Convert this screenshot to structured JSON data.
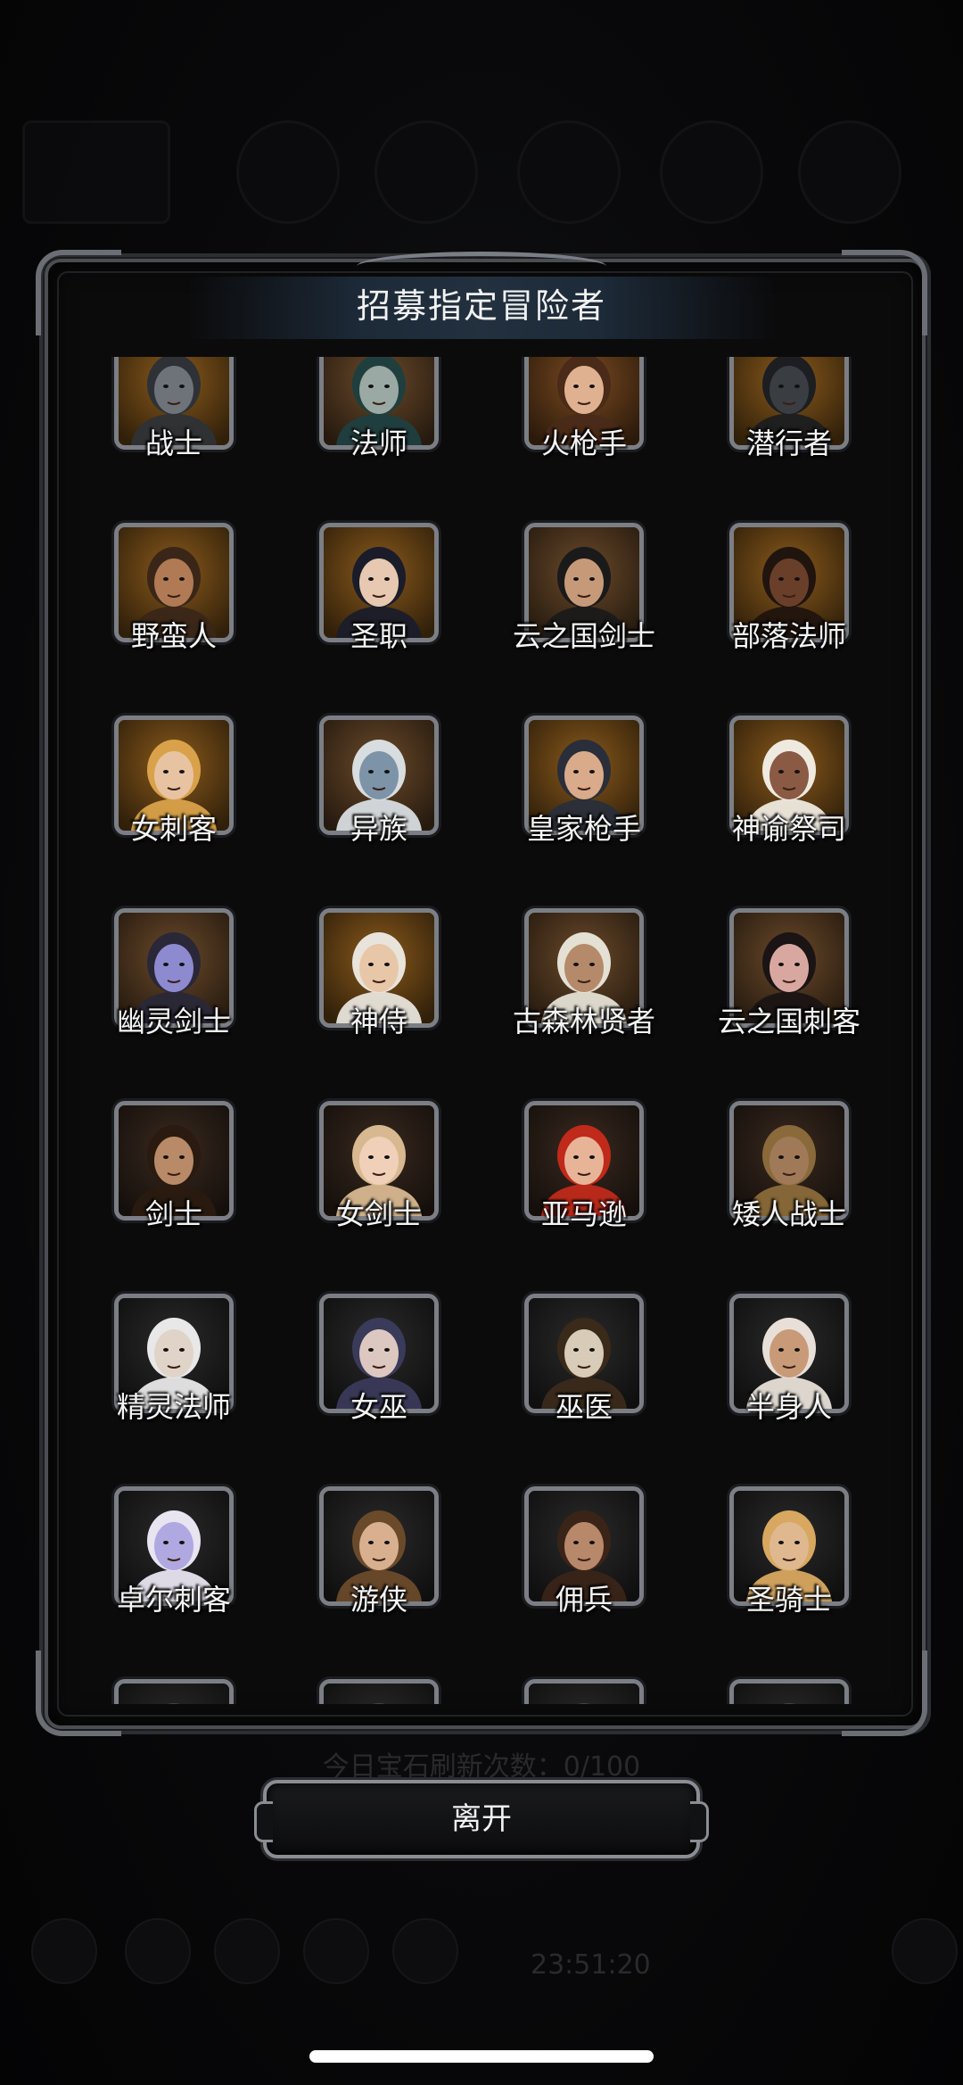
{
  "dialog": {
    "title": "招募指定冒险者"
  },
  "heroes": [
    {
      "name": "战士",
      "portrait_bg": "#8a5a1c",
      "skin": "#6d7378",
      "hair": "#2e3236",
      "icon": "knight-helmet-icon"
    },
    {
      "name": "法师",
      "portrait_bg": "#6b4a2a",
      "skin": "#9aa9a4",
      "hair": "#1f3f3f",
      "icon": "hooded-mage-icon"
    },
    {
      "name": "火枪手",
      "portrait_bg": "#7a4a20",
      "skin": "#e0b190",
      "hair": "#4a2a18",
      "icon": "gunner-portrait-icon"
    },
    {
      "name": "潜行者",
      "portrait_bg": "#8a5a1c",
      "skin": "#3a3d42",
      "hair": "#1c1e21",
      "icon": "masked-rogue-icon"
    },
    {
      "name": "野蛮人",
      "portrait_bg": "#8a5a1c",
      "skin": "#b07a55",
      "hair": "#3a2618",
      "icon": "barbarian-portrait-icon"
    },
    {
      "name": "圣职",
      "portrait_bg": "#8a5a1c",
      "skin": "#e6c9b0",
      "hair": "#1a1c2a",
      "icon": "priestess-portrait-icon"
    },
    {
      "name": "云之国剑士",
      "portrait_bg": "#6b4a2a",
      "skin": "#c69a78",
      "hair": "#1a1a1a",
      "icon": "straw-hat-swordsman-icon"
    },
    {
      "name": "部落法师",
      "portrait_bg": "#8a5a1c",
      "skin": "#6a3f2a",
      "hair": "#20140e",
      "icon": "tribal-shaman-icon"
    },
    {
      "name": "女刺客",
      "portrait_bg": "#8a5a1c",
      "skin": "#e8c3a2",
      "hair": "#d9a24a",
      "icon": "female-assassin-icon"
    },
    {
      "name": "异族",
      "portrait_bg": "#6b4a2a",
      "skin": "#7c93a8",
      "hair": "#d8dde0",
      "icon": "demon-beast-icon"
    },
    {
      "name": "皇家枪手",
      "portrait_bg": "#8a5a1c",
      "skin": "#d9ab8a",
      "hair": "#2a2e3a",
      "icon": "royal-gunner-icon"
    },
    {
      "name": "神谕祭司",
      "portrait_bg": "#8a5a1c",
      "skin": "#8a5a44",
      "hair": "#efeae0",
      "icon": "oracle-priestess-icon"
    },
    {
      "name": "幽灵剑士",
      "portrait_bg": "#6b4a2a",
      "skin": "#8e8ad0",
      "hair": "#2a2838",
      "icon": "ghost-swordsman-icon"
    },
    {
      "name": "神侍",
      "portrait_bg": "#8a5a1c",
      "skin": "#e8c6a8",
      "hair": "#e8e4dc",
      "icon": "templar-squire-icon"
    },
    {
      "name": "古森林贤者",
      "portrait_bg": "#6b4a2a",
      "skin": "#b48a6a",
      "hair": "#e4e0d4",
      "icon": "forest-sage-icon"
    },
    {
      "name": "云之国刺客",
      "portrait_bg": "#6b4a2a",
      "skin": "#d8a8a0",
      "hair": "#1a1414",
      "icon": "cloud-assassin-icon"
    },
    {
      "name": "剑士",
      "portrait_bg": "#3a2a20",
      "skin": "#b88a68",
      "hair": "#2a1a10",
      "icon": "swordsman-portrait-icon"
    },
    {
      "name": "女剑士",
      "portrait_bg": "#3a2a20",
      "skin": "#f0d0b8",
      "hair": "#d8b890",
      "icon": "female-swordsman-icon"
    },
    {
      "name": "亚马逊",
      "portrait_bg": "#3a2a20",
      "skin": "#e8b498",
      "hair": "#c02a1a",
      "icon": "amazon-portrait-icon"
    },
    {
      "name": "矮人战士",
      "portrait_bg": "#3a2a20",
      "skin": "#a07a58",
      "hair": "#8a6a3a",
      "icon": "dwarf-warrior-icon"
    },
    {
      "name": "精灵法师",
      "portrait_bg": "#2a2a2a",
      "skin": "#e0d4c8",
      "hair": "#e8e8e8",
      "icon": "elf-mage-icon"
    },
    {
      "name": "女巫",
      "portrait_bg": "#2a2a2a",
      "skin": "#dcc8c0",
      "hair": "#3a3a5a",
      "icon": "witch-portrait-icon"
    },
    {
      "name": "巫医",
      "portrait_bg": "#2a2a2a",
      "skin": "#d8ccb8",
      "hair": "#3a2a1a",
      "icon": "witch-doctor-mask-icon"
    },
    {
      "name": "半身人",
      "portrait_bg": "#2a2a2a",
      "skin": "#c89a78",
      "hair": "#e8e0d8",
      "icon": "halfling-portrait-icon"
    },
    {
      "name": "卓尔刺客",
      "portrait_bg": "#2a2a2a",
      "skin": "#b0a8e0",
      "hair": "#e8e4f0",
      "icon": "drow-assassin-icon"
    },
    {
      "name": "游侠",
      "portrait_bg": "#2a2a2a",
      "skin": "#d8b090",
      "hair": "#6a4a2a",
      "icon": "ranger-cowboy-icon"
    },
    {
      "name": "佣兵",
      "portrait_bg": "#2a2a2a",
      "skin": "#b8886a",
      "hair": "#3a2418",
      "icon": "mercenary-portrait-icon"
    },
    {
      "name": "圣骑士",
      "portrait_bg": "#2a2a2a",
      "skin": "#e0b890",
      "hair": "#d8a860",
      "icon": "paladin-portrait-icon"
    },
    {
      "name": "",
      "portrait_bg": "#2a2a2a",
      "skin": "#888",
      "hair": "#444",
      "icon": "portrait-icon"
    },
    {
      "name": "",
      "portrait_bg": "#2a2a2a",
      "skin": "#888",
      "hair": "#444",
      "icon": "portrait-icon"
    },
    {
      "name": "",
      "portrait_bg": "#2a2a2a",
      "skin": "#888",
      "hair": "#444",
      "icon": "portrait-icon"
    },
    {
      "name": "",
      "portrait_bg": "#2a2a2a",
      "skin": "#888",
      "hair": "#444",
      "icon": "portrait-icon"
    }
  ],
  "footer": {
    "refresh_count": "今日宝石刷新次数：0/100",
    "leave_button": "离开",
    "timer": "23:51:20"
  }
}
